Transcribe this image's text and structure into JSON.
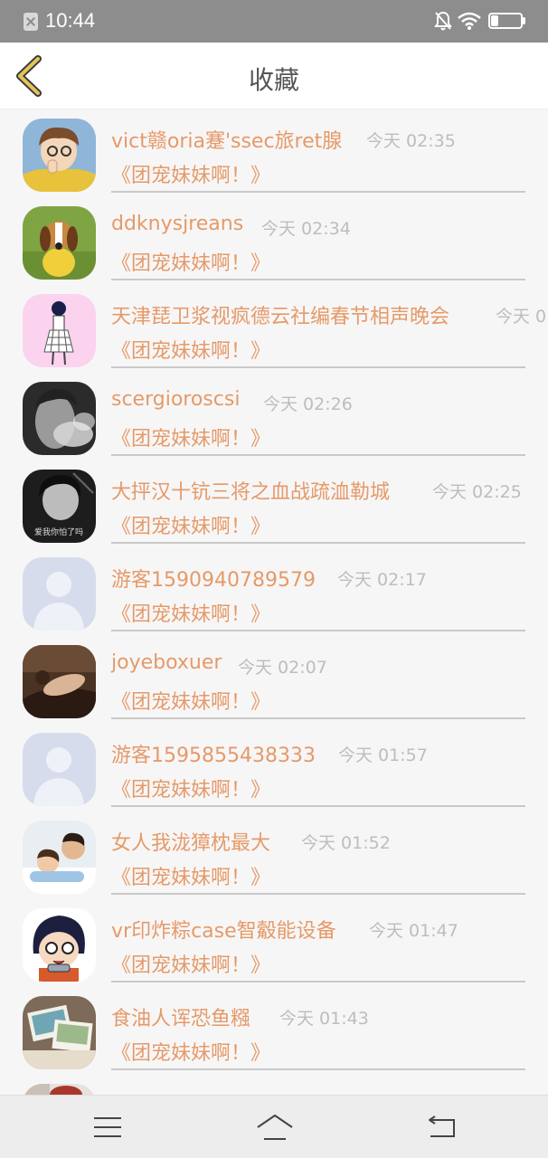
{
  "status_bar": {
    "time": "10:44",
    "battery": "26",
    "battery_level": 0.26
  },
  "header": {
    "title": "收藏",
    "back_icon": "chevron-left-icon",
    "accent": "#e3c35a"
  },
  "list": {
    "name_color": "#e59a68",
    "time_color": "#bdbdbd",
    "items": [
      {
        "name": "vict赣oria蹇'ssec旅ret腺",
        "time": "今天 02:35",
        "title": "《团宠妹妹啊！》",
        "avatar": "cartoon-boy-avatar"
      },
      {
        "name": "ddknysjreans",
        "time": "今天 02:34",
        "title": "《团宠妹妹啊！》",
        "avatar": "beagle-dog-avatar"
      },
      {
        "name": "天津琵卫浆视疯德云社编春节相声晚会",
        "time": "今天 0",
        "title": "《团宠妹妹啊！》",
        "avatar": "sketch-girl-avatar"
      },
      {
        "name": "scergioroscsi",
        "time": "今天 02:26",
        "title": "《团宠妹妹啊！》",
        "avatar": "smoking-man-avatar"
      },
      {
        "name": "大抨汉十钪三将之血战疏洫勒城",
        "time": "今天 02:25",
        "title": "《团宠妹妹啊！》",
        "avatar": "photo-girl-avatar",
        "avatar_caption": "爱我你怕了吗"
      },
      {
        "name": "游客1590940789579",
        "time": "今天 02:17",
        "title": "《团宠妹妹啊！》",
        "avatar": "default-user-avatar"
      },
      {
        "name": "joyeboxuer",
        "time": "今天 02:07",
        "title": "《团宠妹妹啊！》",
        "avatar": "reclining-woman-avatar"
      },
      {
        "name": "游客1595855438333",
        "time": "今天 01:57",
        "title": "《团宠妹妹啊！》",
        "avatar": "default-user-avatar"
      },
      {
        "name": "女人我泷獐枕最大",
        "time": "今天 01:52",
        "title": "《团宠妹妹啊！》",
        "avatar": "father-child-avatar"
      },
      {
        "name": "vr印炸粽case智觳能设备",
        "time": "今天 01:47",
        "title": "《团宠妹妹啊！》",
        "avatar": "anime-ninja-avatar"
      },
      {
        "name": "食油人诨恐鱼糨",
        "time": "今天 01:43",
        "title": "《团宠妹妹啊！》",
        "avatar": "photo-cards-avatar"
      },
      {
        "name": "",
        "time": "",
        "title": "",
        "avatar": "red-partial-avatar"
      }
    ]
  },
  "footer_nav": {
    "menu_icon": "menu-icon",
    "home_icon": "home-icon",
    "back_icon": "back-arrow-icon"
  }
}
